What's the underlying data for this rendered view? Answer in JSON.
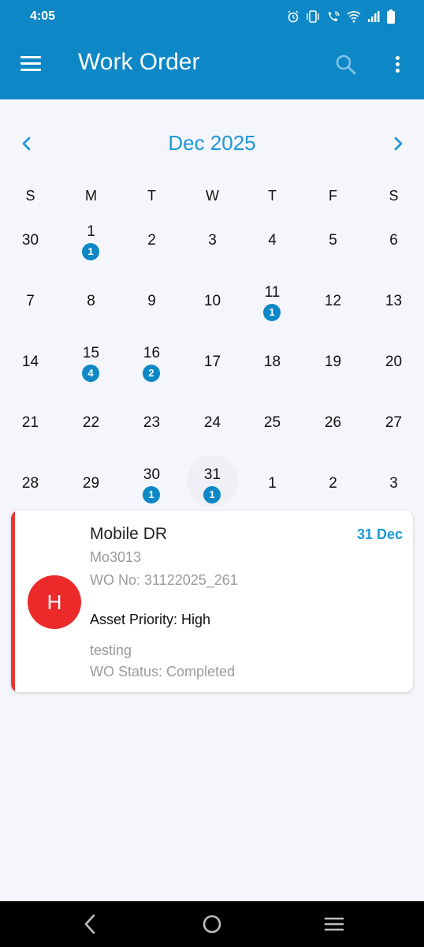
{
  "status_bar": {
    "time": "4:05",
    "icons": [
      "alarm-icon",
      "vibrate-icon",
      "wifi-call-icon",
      "wifi-icon",
      "signal-icon",
      "battery-icon"
    ]
  },
  "app_bar": {
    "title": "Work Order",
    "color": "#0d87c5",
    "icons": [
      "menu-icon",
      "search-icon",
      "more-vert-icon"
    ]
  },
  "calendar": {
    "month_label": "Dec 2025",
    "accent": "#1e98d6",
    "weekdays": [
      "S",
      "M",
      "T",
      "W",
      "T",
      "F",
      "S"
    ],
    "weeks": [
      [
        {
          "d": "30"
        },
        {
          "d": "1",
          "count": "1"
        },
        {
          "d": "2"
        },
        {
          "d": "3"
        },
        {
          "d": "4"
        },
        {
          "d": "5"
        },
        {
          "d": "6"
        }
      ],
      [
        {
          "d": "7"
        },
        {
          "d": "8"
        },
        {
          "d": "9"
        },
        {
          "d": "10"
        },
        {
          "d": "11",
          "count": "1"
        },
        {
          "d": "12"
        },
        {
          "d": "13"
        }
      ],
      [
        {
          "d": "14"
        },
        {
          "d": "15",
          "count": "4"
        },
        {
          "d": "16",
          "count": "2"
        },
        {
          "d": "17"
        },
        {
          "d": "18"
        },
        {
          "d": "19"
        },
        {
          "d": "20"
        }
      ],
      [
        {
          "d": "21"
        },
        {
          "d": "22"
        },
        {
          "d": "23"
        },
        {
          "d": "24"
        },
        {
          "d": "25"
        },
        {
          "d": "26"
        },
        {
          "d": "27"
        }
      ],
      [
        {
          "d": "28"
        },
        {
          "d": "29"
        },
        {
          "d": "30",
          "count": "1"
        },
        {
          "d": "31",
          "count": "1",
          "selected": true
        },
        {
          "d": "1"
        },
        {
          "d": "2"
        },
        {
          "d": "3"
        }
      ]
    ]
  },
  "work_order_card": {
    "avatar_letter": "H",
    "avatar_color": "#ed2a2a",
    "priority_strip_color": "#e53935",
    "title": "Mobile DR",
    "date": "31 Dec",
    "code": "Mo3013",
    "wo_no": "WO No: 31122025_261",
    "asset_priority": "Asset Priority: High",
    "description": "testing",
    "wo_status": "WO Status: Completed"
  },
  "system_nav": {
    "icons": [
      "back-icon",
      "home-icon",
      "recents-icon"
    ]
  }
}
